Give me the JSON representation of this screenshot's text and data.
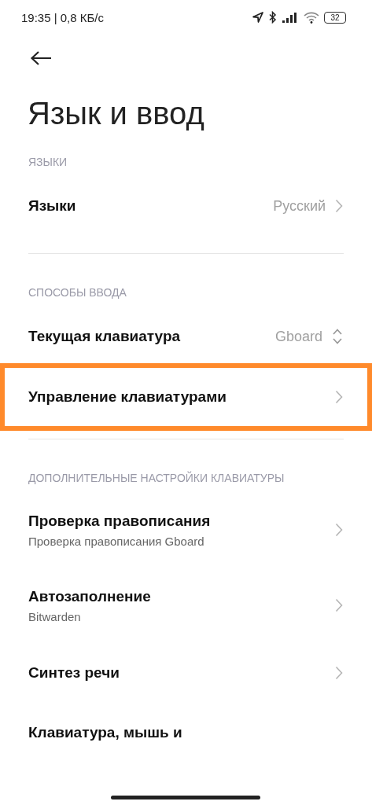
{
  "status_bar": {
    "time": "19:35 | 0,8 КБ/с",
    "battery": "32"
  },
  "title": "Язык и ввод",
  "sections": [
    {
      "header": "ЯЗЫКИ",
      "rows": [
        {
          "title": "Языки",
          "value": "Русский",
          "kind": "chevron",
          "highlighted": false
        }
      ]
    },
    {
      "header": "СПОСОБЫ ВВОДА",
      "rows": [
        {
          "title": "Текущая клавиатура",
          "value": "Gboard",
          "kind": "updown",
          "highlighted": false
        },
        {
          "title": "Управление клавиатурами",
          "kind": "chevron",
          "highlighted": true
        }
      ]
    },
    {
      "header": "ДОПОЛНИТЕЛЬНЫЕ НАСТРОЙКИ КЛАВИАТУРЫ",
      "rows": [
        {
          "title": "Проверка правописания",
          "subtitle": "Проверка правописания Gboard",
          "kind": "chevron",
          "highlighted": false
        },
        {
          "title": "Автозаполнение",
          "subtitle": "Bitwarden",
          "kind": "chevron",
          "highlighted": false
        },
        {
          "title": "Синтез речи",
          "kind": "chevron",
          "highlighted": false
        },
        {
          "title": "Клавиатура, мышь и",
          "kind": "plain",
          "highlighted": false
        }
      ]
    }
  ]
}
